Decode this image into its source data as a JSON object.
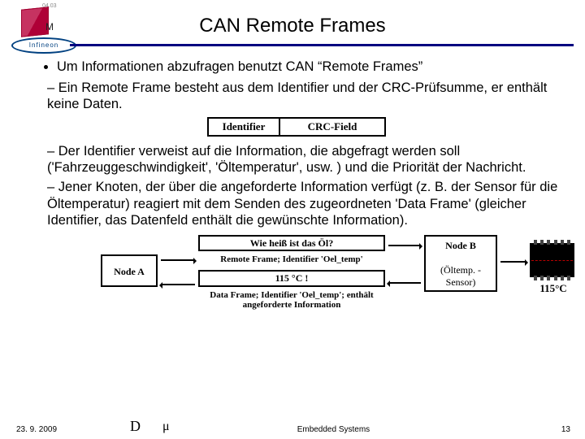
{
  "header": {
    "logo_tag": "04.03",
    "logo_letter": "M",
    "company": "Infineon",
    "title": "CAN Remote Frames"
  },
  "bullets": {
    "main": "Um Informationen abzufragen benutzt CAN “Remote Frames”",
    "sub1": "Ein Remote Frame besteht aus dem Identifier und der CRC-Prüfsumme, er enthält keine Daten.",
    "sub2": "Der Identifier verweist auf die Information, die abgefragt werden soll ('Fahrzeuggeschwindigkeit', 'Öltemperatur', usw. ) und die Priorität der Nachricht.",
    "sub3": "Jener Knoten, der über die angeforderte Information verfügt (z. B. der Sensor für die Öltemperatur) reagiert mit dem Senden des zugeordneten 'Data Frame' (gleicher Identifier, das Datenfeld enthält die gewünschte Information)."
  },
  "frame": {
    "identifier": "Identifier",
    "crc": "CRC-Field"
  },
  "diagram": {
    "nodeA": "Node A",
    "question": "Wie heiß ist das Öl?",
    "remote_frame": "Remote Frame; Identifier 'Oel_temp'",
    "answer": "115 °C !",
    "data_frame": "Data Frame; Identifier 'Oel_temp'; enthält angeforderte Information",
    "nodeB": "Node B",
    "nodeB_sub": "(Öltemp. - Sensor)",
    "temp": "115°C"
  },
  "footer": {
    "date": "23. 9. 2009",
    "author_d": "D",
    "author_mu": "μ",
    "course": "Embedded Systems",
    "page": "13"
  }
}
